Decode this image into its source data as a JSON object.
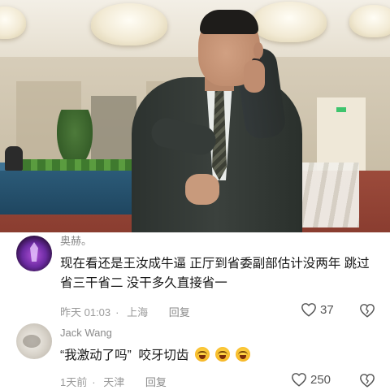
{
  "video": {
    "scene": "video-still"
  },
  "comments": [
    {
      "username": "奥赫。",
      "text": "现在看还是王汝成牛逼 正厅到省委副部估计没两年 跳过省三干省二 没干多久直接省一",
      "time": "昨天 01:03",
      "location": "上海",
      "reply_label": "回复",
      "likes": "37"
    },
    {
      "username": "Jack Wang",
      "text": "“我激动了吗”  咬牙切齿",
      "emoji_count": 3,
      "time": "1天前",
      "location": "天津",
      "reply_label": "回复",
      "likes": "250"
    }
  ],
  "icons": {
    "like": "heart-outline-icon",
    "dislike": "broken-heart-icon",
    "emoji": "laughing-crying-emoji"
  }
}
